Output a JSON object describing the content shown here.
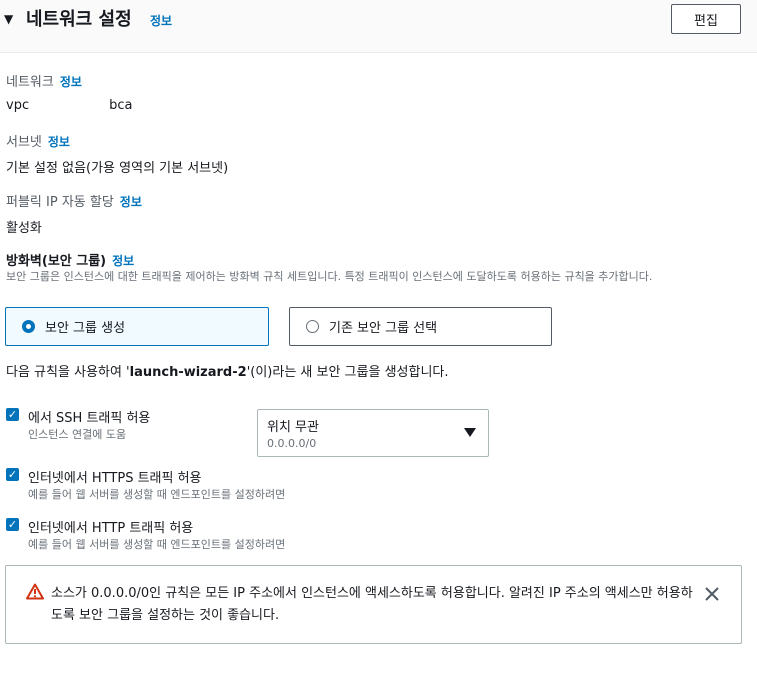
{
  "header": {
    "title": "네트워크 설정",
    "info_label": "정보",
    "edit_label": "편집"
  },
  "network": {
    "label": "네트워크",
    "info_label": "정보",
    "value_prefix": "vpc",
    "value_suffix": "bca"
  },
  "subnet": {
    "label": "서브넷",
    "info_label": "정보",
    "value": "기본 설정 없음(가용 영역의 기본 서브넷)"
  },
  "public_ip": {
    "label": "퍼블릭 IP 자동 할당",
    "info_label": "정보",
    "value": "활성화"
  },
  "firewall": {
    "label": "방화벽(보안 그룹)",
    "info_label": "정보",
    "description": "보안 그룹은 인스턴스에 대한 트래픽을 제어하는 방화벽 규칙 세트입니다. 특정 트래픽이 인스턴스에 도달하도록 허용하는 규칙을 추가합니다.",
    "options": [
      {
        "label": "보안 그룹 생성",
        "selected": true
      },
      {
        "label": "기존 보안 그룹 선택",
        "selected": false
      }
    ],
    "rule_desc_prefix": "다음 규칙을 사용하여 '",
    "rule_desc_name": "launch-wizard-2",
    "rule_desc_suffix": "'(이)라는 새 보안 그룹을 생성합니다."
  },
  "rules": [
    {
      "label": "에서 SSH 트래픽 허용",
      "sub": "인스턴스 연결에 도움",
      "checked": true
    },
    {
      "label": "인터넷에서 HTTPS 트래픽 허용",
      "sub": "예를 들어 웹 서버를 생성할 때 엔드포인트를 설정하려면",
      "checked": true
    },
    {
      "label": "인터넷에서 HTTP 트래픽 허용",
      "sub": "예를 들어 웹 서버를 생성할 때 엔드포인트를 설정하려면",
      "checked": true
    }
  ],
  "ssh_source": {
    "selected": "위치 무관",
    "sub": "0.0.0.0/0"
  },
  "alert": {
    "text": "소스가 0.0.0.0/0인 규칙은 모든 IP 주소에서 인스턴스에 액세스하도록 허용합니다. 알려진 IP 주소의 액세스만 허용하도록 보안 그룹을 설정하는 것이 좋습니다.",
    "icon": "warning-icon",
    "icon_color": "#d13212"
  },
  "colors": {
    "accent": "#0073bb",
    "warning": "#d13212"
  }
}
